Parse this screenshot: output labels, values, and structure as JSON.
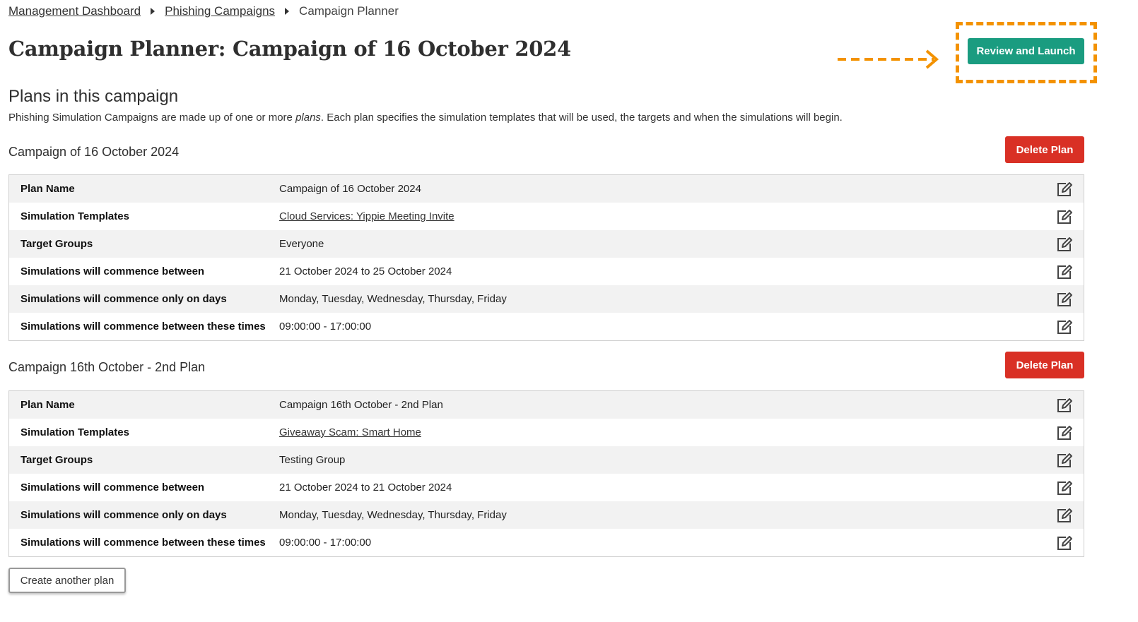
{
  "breadcrumb": {
    "items": [
      "Management Dashboard",
      "Phishing Campaigns"
    ],
    "current": "Campaign Planner"
  },
  "page_title": "Campaign Planner: Campaign of 16 October 2024",
  "launch_button": "Review and Launch",
  "section": {
    "title": "Plans in this campaign",
    "desc_before": "Phishing Simulation Campaigns are made up of one or more ",
    "desc_em": "plans",
    "desc_after": ". Each plan specifies the simulation templates that will be used, the targets and when the simulations will begin."
  },
  "delete_label": "Delete Plan",
  "plans": [
    {
      "title": "Campaign of 16 October 2024",
      "rows": [
        {
          "label": "Plan Name",
          "value": "Campaign of 16 October 2024"
        },
        {
          "label": "Simulation Templates",
          "value": "Cloud Services: Yippie Meeting Invite"
        },
        {
          "label": "Target Groups",
          "value": "Everyone"
        },
        {
          "label": "Simulations will commence between",
          "value": "21 October 2024 to 25 October 2024"
        },
        {
          "label": "Simulations will commence only on days",
          "value": "Monday, Tuesday, Wednesday, Thursday, Friday"
        },
        {
          "label": "Simulations will commence between these times",
          "value": "09:00:00 - 17:00:00"
        }
      ]
    },
    {
      "title": "Campaign 16th October - 2nd Plan",
      "rows": [
        {
          "label": "Plan Name",
          "value": "Campaign 16th October - 2nd Plan"
        },
        {
          "label": "Simulation Templates",
          "value": "Giveaway Scam: Smart Home"
        },
        {
          "label": "Target Groups",
          "value": "Testing Group"
        },
        {
          "label": "Simulations will commence between",
          "value": "21 October 2024 to 21 October 2024"
        },
        {
          "label": "Simulations will commence only on days",
          "value": "Monday, Tuesday, Wednesday, Thursday, Friday"
        },
        {
          "label": "Simulations will commence between these times",
          "value": "09:00:00 - 17:00:00"
        }
      ]
    }
  ],
  "create_button": "Create another plan",
  "icons": {
    "edit": "edit-icon",
    "separator": "caret-right-icon",
    "arrow": "dashed-arrow-right-icon"
  },
  "colors": {
    "launch": "#1a9c80",
    "delete": "#d93025",
    "highlight": "#f39200"
  }
}
